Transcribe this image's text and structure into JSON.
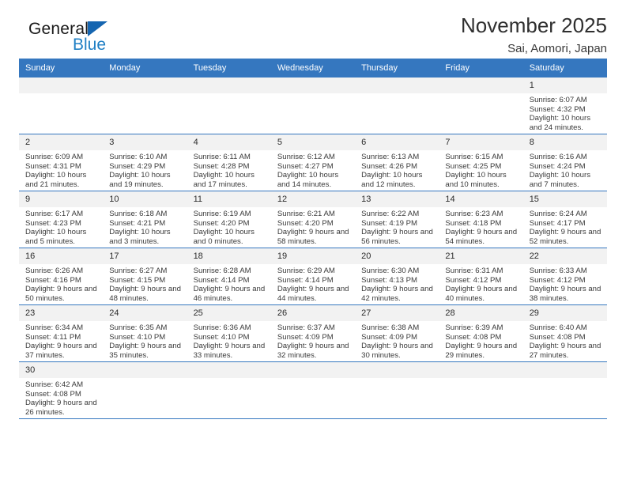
{
  "brand": {
    "name_part1": "General",
    "name_part2": "Blue",
    "icon": "triangle-flag-icon",
    "accent_color": "#1565b0"
  },
  "header": {
    "title": "November 2025",
    "subtitle": "Sai, Aomori, Japan"
  },
  "calendar": {
    "header_color": "#3577bf",
    "weekdays": [
      "Sunday",
      "Monday",
      "Tuesday",
      "Wednesday",
      "Thursday",
      "Friday",
      "Saturday"
    ],
    "weeks": [
      [
        {
          "day": "",
          "empty": true
        },
        {
          "day": "",
          "empty": true
        },
        {
          "day": "",
          "empty": true
        },
        {
          "day": "",
          "empty": true
        },
        {
          "day": "",
          "empty": true
        },
        {
          "day": "",
          "empty": true
        },
        {
          "day": "1",
          "sunrise": "Sunrise: 6:07 AM",
          "sunset": "Sunset: 4:32 PM",
          "daylight": "Daylight: 10 hours and 24 minutes."
        }
      ],
      [
        {
          "day": "2",
          "sunrise": "Sunrise: 6:09 AM",
          "sunset": "Sunset: 4:31 PM",
          "daylight": "Daylight: 10 hours and 21 minutes."
        },
        {
          "day": "3",
          "sunrise": "Sunrise: 6:10 AM",
          "sunset": "Sunset: 4:29 PM",
          "daylight": "Daylight: 10 hours and 19 minutes."
        },
        {
          "day": "4",
          "sunrise": "Sunrise: 6:11 AM",
          "sunset": "Sunset: 4:28 PM",
          "daylight": "Daylight: 10 hours and 17 minutes."
        },
        {
          "day": "5",
          "sunrise": "Sunrise: 6:12 AM",
          "sunset": "Sunset: 4:27 PM",
          "daylight": "Daylight: 10 hours and 14 minutes."
        },
        {
          "day": "6",
          "sunrise": "Sunrise: 6:13 AM",
          "sunset": "Sunset: 4:26 PM",
          "daylight": "Daylight: 10 hours and 12 minutes."
        },
        {
          "day": "7",
          "sunrise": "Sunrise: 6:15 AM",
          "sunset": "Sunset: 4:25 PM",
          "daylight": "Daylight: 10 hours and 10 minutes."
        },
        {
          "day": "8",
          "sunrise": "Sunrise: 6:16 AM",
          "sunset": "Sunset: 4:24 PM",
          "daylight": "Daylight: 10 hours and 7 minutes."
        }
      ],
      [
        {
          "day": "9",
          "sunrise": "Sunrise: 6:17 AM",
          "sunset": "Sunset: 4:23 PM",
          "daylight": "Daylight: 10 hours and 5 minutes."
        },
        {
          "day": "10",
          "sunrise": "Sunrise: 6:18 AM",
          "sunset": "Sunset: 4:21 PM",
          "daylight": "Daylight: 10 hours and 3 minutes."
        },
        {
          "day": "11",
          "sunrise": "Sunrise: 6:19 AM",
          "sunset": "Sunset: 4:20 PM",
          "daylight": "Daylight: 10 hours and 0 minutes."
        },
        {
          "day": "12",
          "sunrise": "Sunrise: 6:21 AM",
          "sunset": "Sunset: 4:20 PM",
          "daylight": "Daylight: 9 hours and 58 minutes."
        },
        {
          "day": "13",
          "sunrise": "Sunrise: 6:22 AM",
          "sunset": "Sunset: 4:19 PM",
          "daylight": "Daylight: 9 hours and 56 minutes."
        },
        {
          "day": "14",
          "sunrise": "Sunrise: 6:23 AM",
          "sunset": "Sunset: 4:18 PM",
          "daylight": "Daylight: 9 hours and 54 minutes."
        },
        {
          "day": "15",
          "sunrise": "Sunrise: 6:24 AM",
          "sunset": "Sunset: 4:17 PM",
          "daylight": "Daylight: 9 hours and 52 minutes."
        }
      ],
      [
        {
          "day": "16",
          "sunrise": "Sunrise: 6:26 AM",
          "sunset": "Sunset: 4:16 PM",
          "daylight": "Daylight: 9 hours and 50 minutes."
        },
        {
          "day": "17",
          "sunrise": "Sunrise: 6:27 AM",
          "sunset": "Sunset: 4:15 PM",
          "daylight": "Daylight: 9 hours and 48 minutes."
        },
        {
          "day": "18",
          "sunrise": "Sunrise: 6:28 AM",
          "sunset": "Sunset: 4:14 PM",
          "daylight": "Daylight: 9 hours and 46 minutes."
        },
        {
          "day": "19",
          "sunrise": "Sunrise: 6:29 AM",
          "sunset": "Sunset: 4:14 PM",
          "daylight": "Daylight: 9 hours and 44 minutes."
        },
        {
          "day": "20",
          "sunrise": "Sunrise: 6:30 AM",
          "sunset": "Sunset: 4:13 PM",
          "daylight": "Daylight: 9 hours and 42 minutes."
        },
        {
          "day": "21",
          "sunrise": "Sunrise: 6:31 AM",
          "sunset": "Sunset: 4:12 PM",
          "daylight": "Daylight: 9 hours and 40 minutes."
        },
        {
          "day": "22",
          "sunrise": "Sunrise: 6:33 AM",
          "sunset": "Sunset: 4:12 PM",
          "daylight": "Daylight: 9 hours and 38 minutes."
        }
      ],
      [
        {
          "day": "23",
          "sunrise": "Sunrise: 6:34 AM",
          "sunset": "Sunset: 4:11 PM",
          "daylight": "Daylight: 9 hours and 37 minutes."
        },
        {
          "day": "24",
          "sunrise": "Sunrise: 6:35 AM",
          "sunset": "Sunset: 4:10 PM",
          "daylight": "Daylight: 9 hours and 35 minutes."
        },
        {
          "day": "25",
          "sunrise": "Sunrise: 6:36 AM",
          "sunset": "Sunset: 4:10 PM",
          "daylight": "Daylight: 9 hours and 33 minutes."
        },
        {
          "day": "26",
          "sunrise": "Sunrise: 6:37 AM",
          "sunset": "Sunset: 4:09 PM",
          "daylight": "Daylight: 9 hours and 32 minutes."
        },
        {
          "day": "27",
          "sunrise": "Sunrise: 6:38 AM",
          "sunset": "Sunset: 4:09 PM",
          "daylight": "Daylight: 9 hours and 30 minutes."
        },
        {
          "day": "28",
          "sunrise": "Sunrise: 6:39 AM",
          "sunset": "Sunset: 4:08 PM",
          "daylight": "Daylight: 9 hours and 29 minutes."
        },
        {
          "day": "29",
          "sunrise": "Sunrise: 6:40 AM",
          "sunset": "Sunset: 4:08 PM",
          "daylight": "Daylight: 9 hours and 27 minutes."
        }
      ],
      [
        {
          "day": "30",
          "sunrise": "Sunrise: 6:42 AM",
          "sunset": "Sunset: 4:08 PM",
          "daylight": "Daylight: 9 hours and 26 minutes."
        },
        {
          "day": "",
          "empty": true
        },
        {
          "day": "",
          "empty": true
        },
        {
          "day": "",
          "empty": true
        },
        {
          "day": "",
          "empty": true
        },
        {
          "day": "",
          "empty": true
        },
        {
          "day": "",
          "empty": true
        }
      ]
    ]
  }
}
